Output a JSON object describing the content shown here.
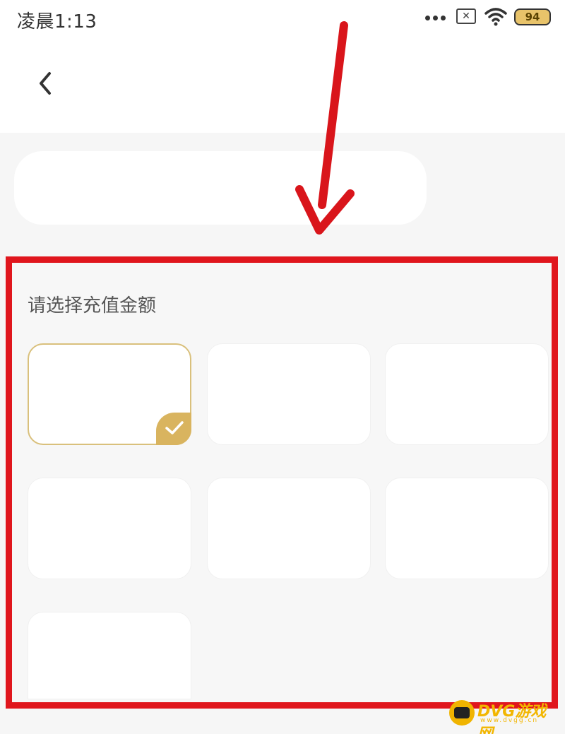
{
  "status_bar": {
    "time": "凌晨1:13",
    "battery": "94",
    "sim_icon": "sim-off-icon",
    "signal_icon": "wifi-icon"
  },
  "nav": {
    "back_icon": "chevron-left-icon"
  },
  "recharge": {
    "title": "请选择充值金额",
    "options": [
      {
        "label": "",
        "selected": true
      },
      {
        "label": "",
        "selected": false
      },
      {
        "label": "",
        "selected": false
      },
      {
        "label": "",
        "selected": false
      },
      {
        "label": "",
        "selected": false
      },
      {
        "label": "",
        "selected": false
      },
      {
        "label": "",
        "selected": false
      }
    ]
  },
  "colors": {
    "highlight_border": "#e0161d",
    "selected_border": "#d9c07c",
    "check_badge": "#d9b45f",
    "arrow": "#d9151b"
  },
  "watermark": {
    "brand": "DVG游戏网",
    "domain": "www.dvgg.cn"
  }
}
